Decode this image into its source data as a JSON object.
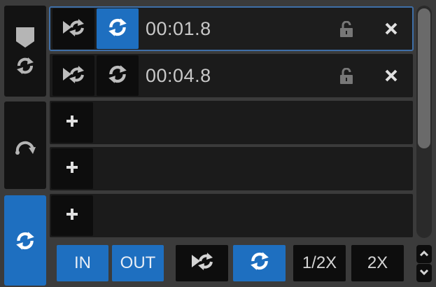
{
  "sidebar": {
    "items": [
      {
        "name": "hotcue-mode",
        "icons": [
          "marker-icon",
          "loop-icon"
        ],
        "active": false
      },
      {
        "name": "roll-mode",
        "icons": [
          "roll-arc-icon"
        ],
        "active": false
      },
      {
        "name": "loop-mode",
        "icons": [
          "loop-icon"
        ],
        "active": true
      }
    ]
  },
  "loops": [
    {
      "time": "00:01.8",
      "loop_active": true,
      "selected": true,
      "lock_icon": "lock-open-icon",
      "close_icon": "close-icon"
    },
    {
      "time": "00:04.8",
      "loop_active": false,
      "selected": false,
      "lock_icon": "lock-open-icon",
      "close_icon": "close-icon"
    }
  ],
  "empty_slots": [
    {
      "label": "+"
    },
    {
      "label": "+"
    },
    {
      "label": "+"
    }
  ],
  "bottom_bar": {
    "in_label": "IN",
    "out_label": "OUT",
    "half_label": "1/2X",
    "double_label": "2X"
  },
  "colors": {
    "accent": "#1e6fc0",
    "button_bg": "#0d0d0d",
    "row_bg": "#1b1b1b",
    "panel_bg": "#3b3b3b",
    "text": "#c8c8c8",
    "selected_outline": "#3f6fa8"
  }
}
